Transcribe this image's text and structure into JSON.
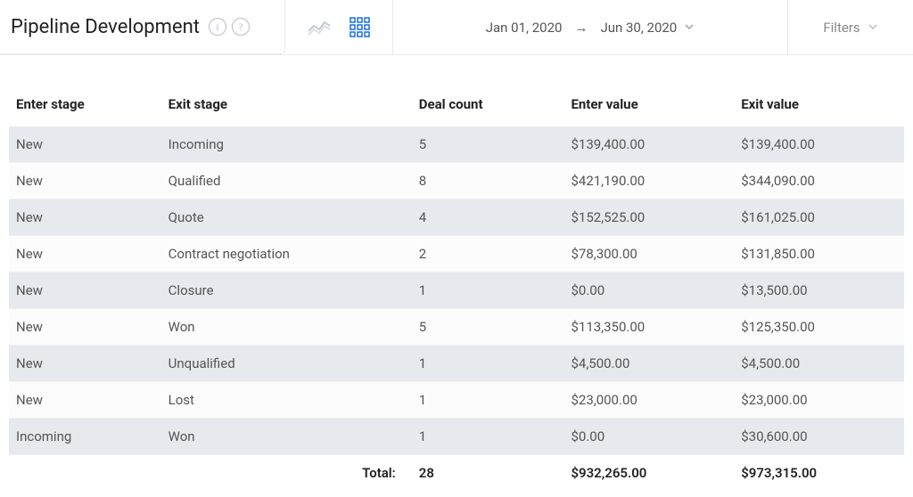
{
  "header": {
    "title": "Pipeline Development",
    "info_glyph": "i",
    "help_glyph": "?"
  },
  "date": {
    "start": "Jan 01, 2020",
    "arrow": "→",
    "end": "Jun 30, 2020"
  },
  "filters_label": "Filters",
  "table": {
    "columns": {
      "enter_stage": "Enter stage",
      "exit_stage": "Exit stage",
      "deal_count": "Deal count",
      "enter_value": "Enter value",
      "exit_value": "Exit value"
    },
    "rows": [
      {
        "enter_stage": "New",
        "exit_stage": "Incoming",
        "deal_count": "5",
        "enter_value": "$139,400.00",
        "exit_value": "$139,400.00"
      },
      {
        "enter_stage": "New",
        "exit_stage": "Qualified",
        "deal_count": "8",
        "enter_value": "$421,190.00",
        "exit_value": "$344,090.00"
      },
      {
        "enter_stage": "New",
        "exit_stage": "Quote",
        "deal_count": "4",
        "enter_value": "$152,525.00",
        "exit_value": "$161,025.00"
      },
      {
        "enter_stage": "New",
        "exit_stage": "Contract negotiation",
        "deal_count": "2",
        "enter_value": "$78,300.00",
        "exit_value": "$131,850.00"
      },
      {
        "enter_stage": "New",
        "exit_stage": "Closure",
        "deal_count": "1",
        "enter_value": "$0.00",
        "exit_value": "$13,500.00"
      },
      {
        "enter_stage": "New",
        "exit_stage": "Won",
        "deal_count": "5",
        "enter_value": "$113,350.00",
        "exit_value": "$125,350.00"
      },
      {
        "enter_stage": "New",
        "exit_stage": "Unqualified",
        "deal_count": "1",
        "enter_value": "$4,500.00",
        "exit_value": "$4,500.00"
      },
      {
        "enter_stage": "New",
        "exit_stage": "Lost",
        "deal_count": "1",
        "enter_value": "$23,000.00",
        "exit_value": "$23,000.00"
      },
      {
        "enter_stage": "Incoming",
        "exit_stage": "Won",
        "deal_count": "1",
        "enter_value": "$0.00",
        "exit_value": "$30,600.00"
      }
    ],
    "total": {
      "label": "Total:",
      "deal_count": "28",
      "enter_value": "$932,265.00",
      "exit_value": "$973,315.00"
    }
  }
}
